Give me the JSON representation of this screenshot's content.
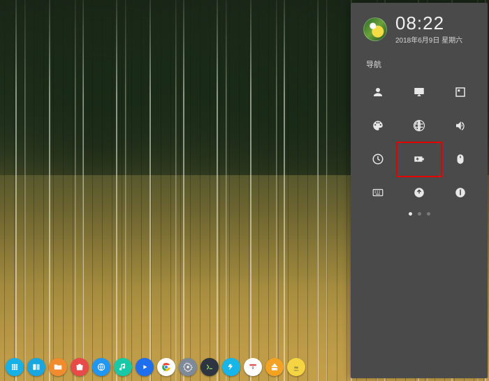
{
  "clock": {
    "time": "08:22",
    "date": "2018年6月9日 星期六"
  },
  "sidepanel": {
    "section_title": "导航",
    "nav_items": [
      {
        "name": "account-icon"
      },
      {
        "name": "display-icon"
      },
      {
        "name": "default-apps-icon"
      },
      {
        "name": "personalize-icon"
      },
      {
        "name": "network-icon"
      },
      {
        "name": "sound-icon"
      },
      {
        "name": "datetime-icon"
      },
      {
        "name": "power-icon"
      },
      {
        "name": "mouse-icon"
      },
      {
        "name": "keyboard-icon"
      },
      {
        "name": "update-icon"
      },
      {
        "name": "sysinfo-icon"
      }
    ],
    "highlighted_index": 7,
    "pager": {
      "count": 3,
      "active": 0
    }
  },
  "dock": {
    "items": [
      {
        "name": "launcher-icon",
        "bg": "#18b1e7"
      },
      {
        "name": "task-view-icon",
        "bg": "#1aa7e0"
      },
      {
        "name": "file-manager-icon",
        "bg": "#f08c2e"
      },
      {
        "name": "store-icon",
        "bg": "#e84a4a"
      },
      {
        "name": "browser-icon",
        "bg": "#2196f3"
      },
      {
        "name": "music-icon",
        "bg": "#18c9a8"
      },
      {
        "name": "video-icon",
        "bg": "#1e6ef0"
      },
      {
        "name": "chrome-icon",
        "bg": "#ffffff"
      },
      {
        "name": "settings-icon",
        "bg": "#7e8a97"
      },
      {
        "name": "terminal-icon",
        "bg": "#2e3440"
      },
      {
        "name": "monitor-icon",
        "bg": "#18b6e8"
      },
      {
        "name": "calendar-icon",
        "bg": "#ffffff"
      },
      {
        "name": "disk-icon",
        "bg": "#f4a224"
      },
      {
        "name": "voice-icon",
        "bg": "#f5d443"
      }
    ]
  }
}
